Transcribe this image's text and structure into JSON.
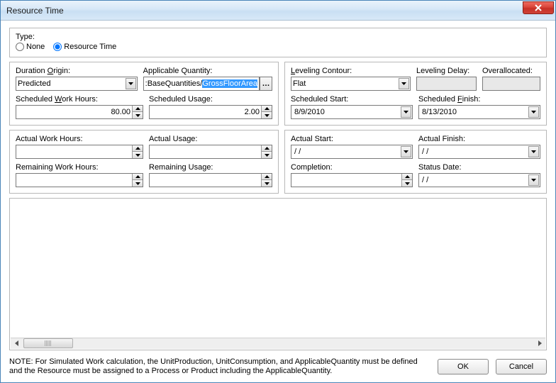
{
  "window": {
    "title": "Resource Time"
  },
  "typePanel": {
    "label": "Type:",
    "none": "None",
    "resourceTime": "Resource Time",
    "selected": "resourceTime"
  },
  "durationOrigin": {
    "label_pre": "Duration ",
    "label_u": "O",
    "label_post": "rigin:",
    "value": "Predicted"
  },
  "applicableQuantity": {
    "label": "Applicable Quantity:",
    "pre": ":BaseQuantities/",
    "sel": "GrossFloorArea"
  },
  "scheduledWorkHours": {
    "label_pre": "Scheduled ",
    "label_u": "W",
    "label_post": "ork Hours:",
    "value": "80.00"
  },
  "scheduledUsage": {
    "label": "Scheduled Usage:",
    "value": "2.00"
  },
  "levelingContour": {
    "labelHtml": "Leveling Contour:",
    "value": "Flat"
  },
  "levelingDelay": {
    "label": "Leveling Delay:",
    "value": ""
  },
  "overallocated": {
    "label": "Overallocated:",
    "value": ""
  },
  "scheduledStart": {
    "label": "Scheduled Start:",
    "value": "8/9/2010"
  },
  "scheduledFinish": {
    "labelHtml": "Scheduled Finish:",
    "value": "8/13/2010"
  },
  "actualWorkHours": {
    "label": "Actual Work Hours:",
    "value": ""
  },
  "actualUsage": {
    "label": "Actual Usage:",
    "value": ""
  },
  "remainingWorkHours": {
    "label": "Remaining Work Hours:",
    "value": ""
  },
  "remainingUsage": {
    "label": "Remaining Usage:",
    "value": ""
  },
  "actualStart": {
    "label": "Actual Start:",
    "value": "  /   /"
  },
  "actualFinish": {
    "label": "Actual Finish:",
    "value": "  /   /"
  },
  "completion": {
    "label": "Completion:",
    "value": ""
  },
  "statusDate": {
    "label": "Status Date:",
    "value": "  /   /"
  },
  "note": "NOTE: For Simulated Work calculation, the UnitProduction, UnitConsumption, and ApplicableQuantity must be defined and the Resource must be assigned to a Process or Product including the ApplicableQuantity.",
  "buttons": {
    "ok": "OK",
    "cancel": "Cancel"
  }
}
